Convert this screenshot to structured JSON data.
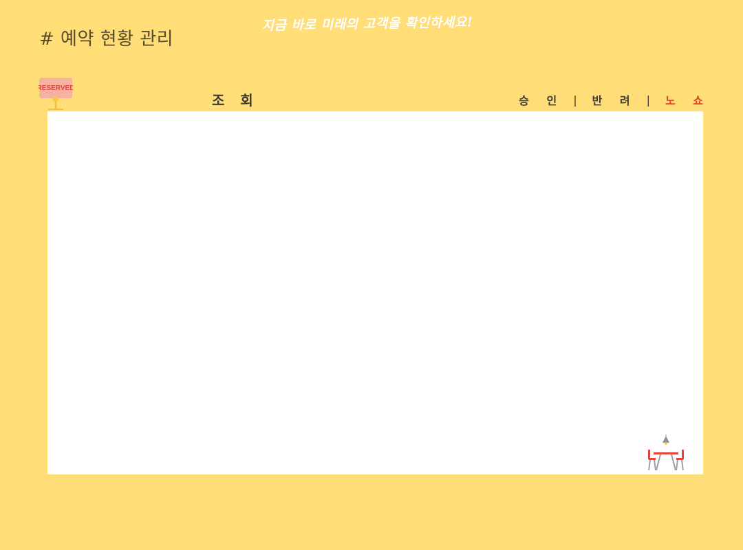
{
  "header": {
    "banner_text": "지금 바로 미래의 고객을 확인하세요!",
    "page_title": "# 예약 현황 관리"
  },
  "reserved_sign": {
    "text": "RESERVED"
  },
  "tabs": {
    "lookup_label": "조 회",
    "approve_label": "승 인",
    "reject_label": "반 려",
    "noshow_label": "노 쇼",
    "separator": "|"
  },
  "colors": {
    "background": "#FFDD77",
    "panel": "#FFFFFF",
    "text_dark": "#3C3A30",
    "title": "#554A2A",
    "noshow_red": "#E63A2A",
    "sign_pink": "#F6B2A0",
    "sign_text": "#E0443A"
  },
  "icons": {
    "reserved": "reserved-sign-icon",
    "table": "dining-table-icon"
  }
}
